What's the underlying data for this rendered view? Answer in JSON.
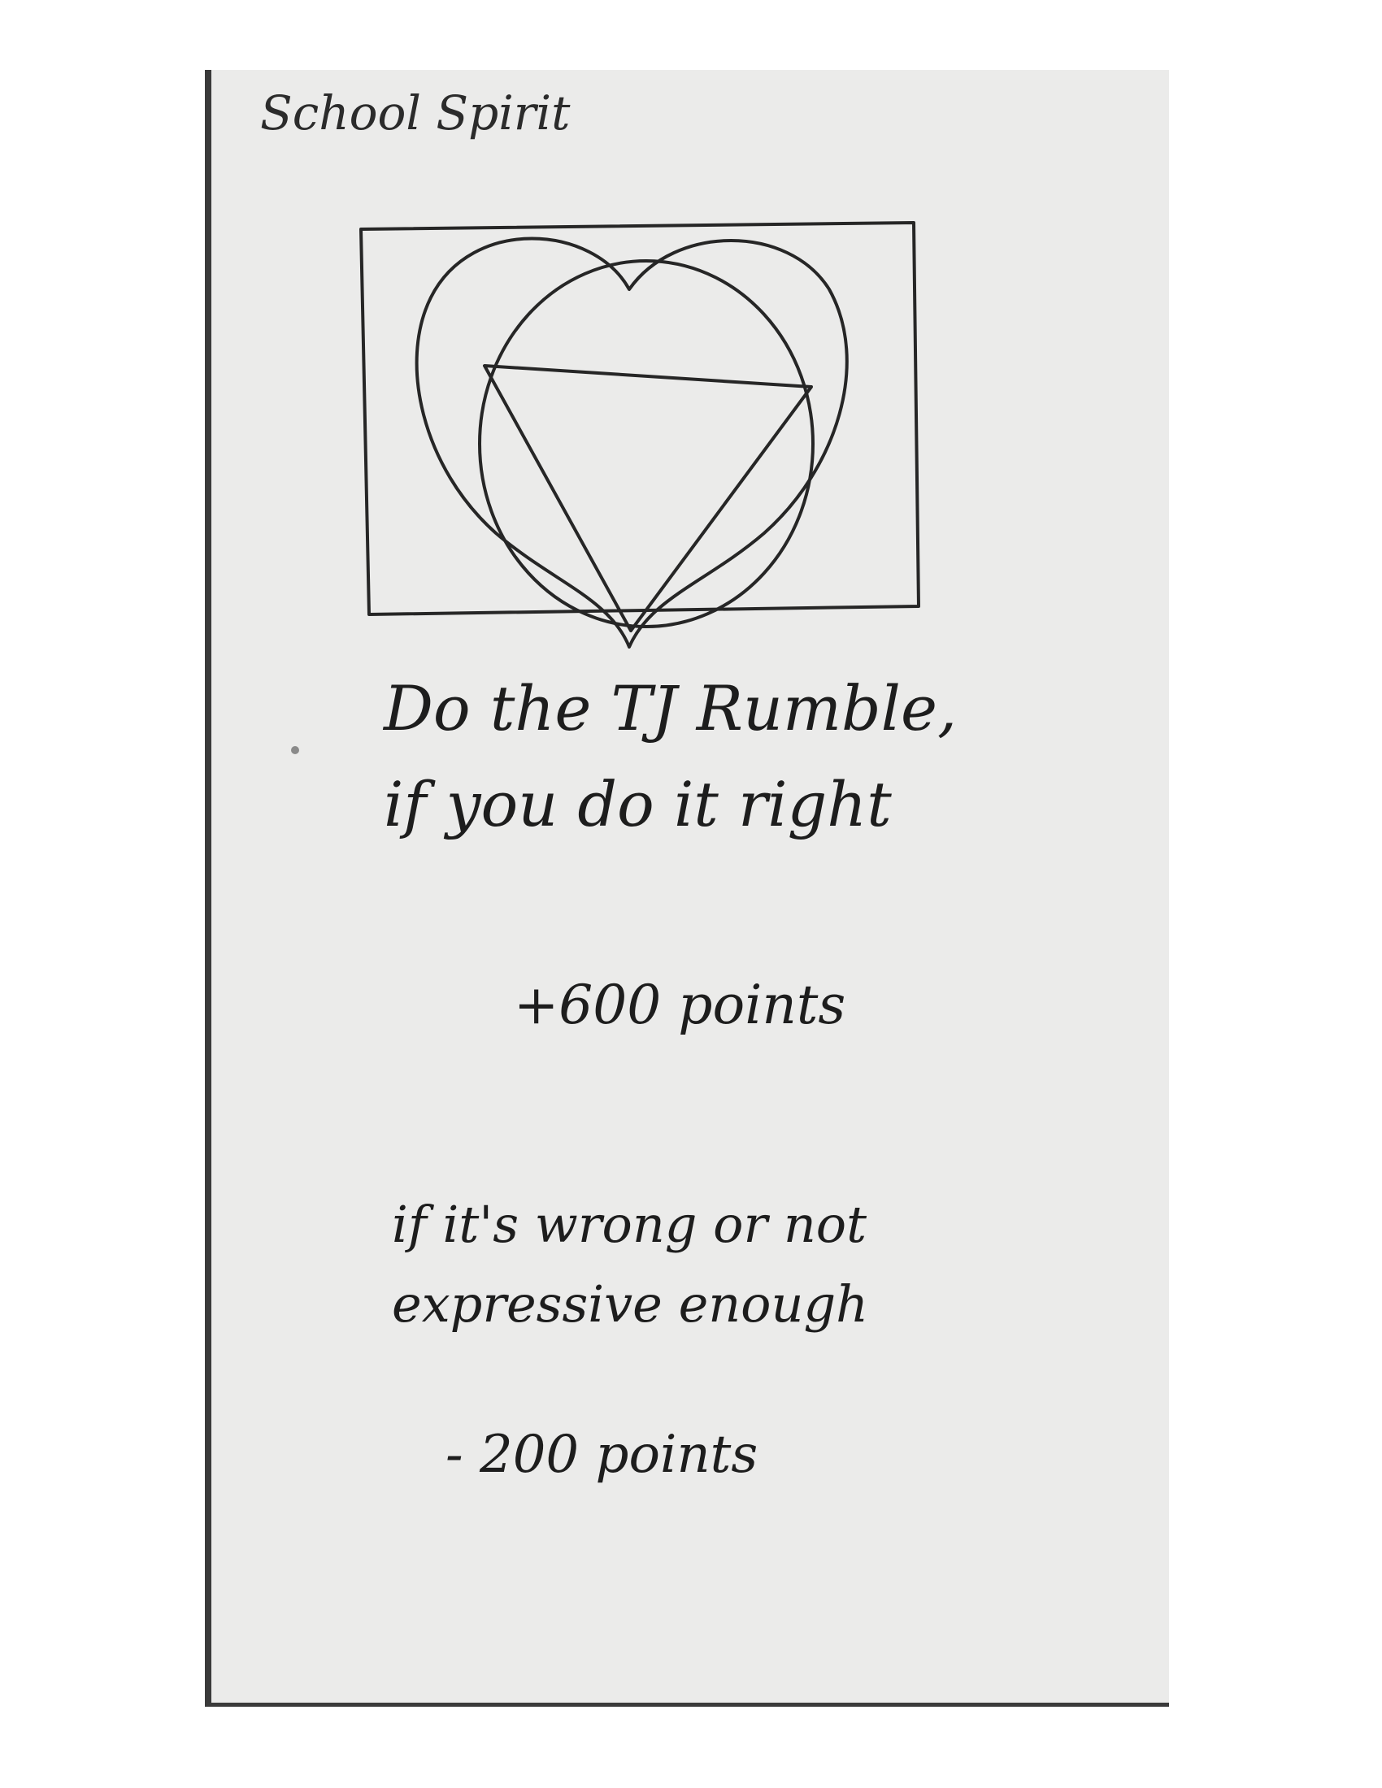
{
  "card": {
    "title": "School Spirit",
    "task_line_1": "Do the TJ Rumble,",
    "task_line_2": "if you do it right",
    "reward": "+600 points",
    "penalty_line_1": "if it's wrong or not",
    "penalty_line_2": "expressive enough",
    "penalty": "- 200 points"
  },
  "sketch": {
    "icon": "heart-triangle-drawing-icon"
  },
  "colors": {
    "paper": "#ebebea",
    "ink": "#1d1d1d",
    "background": "#ffffff"
  }
}
